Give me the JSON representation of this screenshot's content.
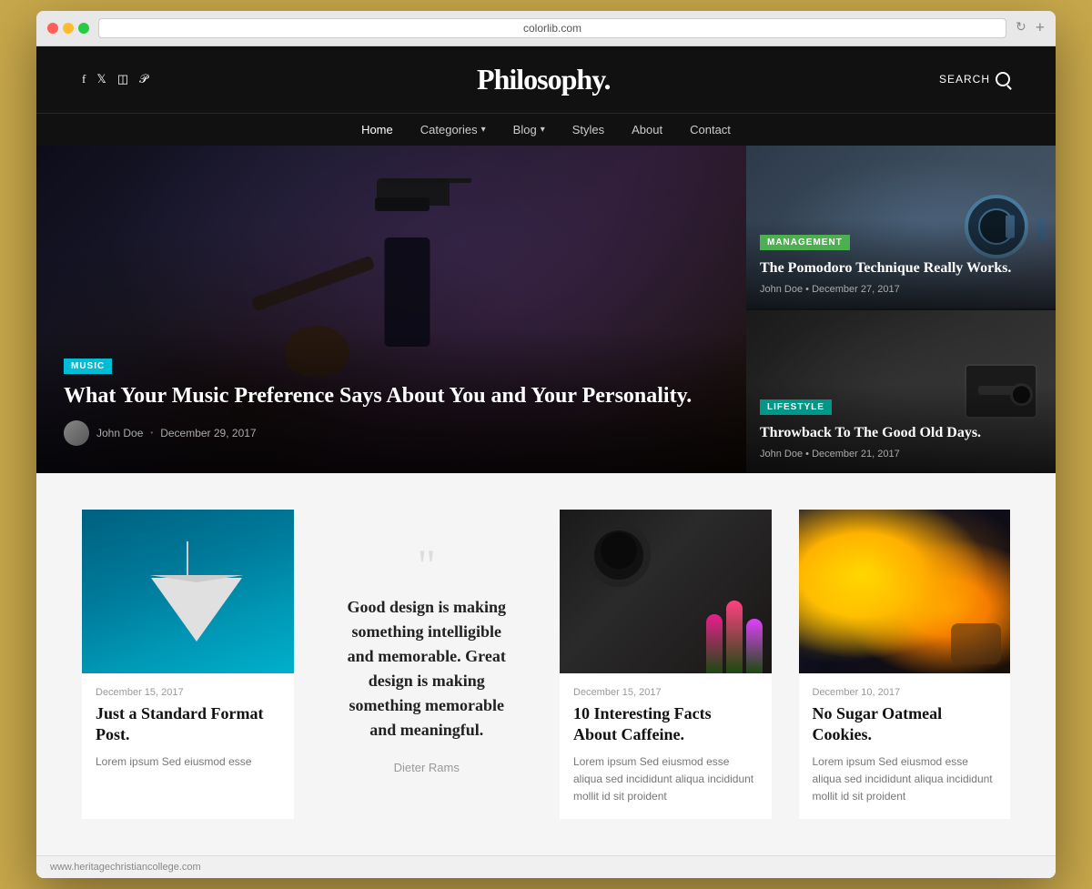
{
  "browser": {
    "url": "colorlib.com",
    "refresh_label": "↻",
    "add_tab_label": "+"
  },
  "header": {
    "logo": "Philosophy.",
    "search_label": "SEARCH",
    "social_icons": [
      "f",
      "t",
      "◻",
      "p"
    ]
  },
  "nav": {
    "items": [
      {
        "label": "Home",
        "active": true,
        "has_dropdown": false
      },
      {
        "label": "Categories",
        "active": false,
        "has_dropdown": true
      },
      {
        "label": "Blog",
        "active": false,
        "has_dropdown": true
      },
      {
        "label": "Styles",
        "active": false,
        "has_dropdown": false
      },
      {
        "label": "About",
        "active": false,
        "has_dropdown": false
      },
      {
        "label": "Contact",
        "active": false,
        "has_dropdown": false
      }
    ]
  },
  "hero": {
    "main": {
      "tag": "MUSIC",
      "title": "What Your Music Preference Says About You and Your Personality.",
      "author": "John Doe",
      "date": "December 29, 2017"
    },
    "side_top": {
      "tag": "MANAGEMENT",
      "title": "The Pomodoro Technique Really Works.",
      "author": "John Doe",
      "date": "December 27, 2017"
    },
    "side_bottom": {
      "tag": "LIFESTYLE",
      "title": "Throwback To The Good Old Days.",
      "author": "John Doe",
      "date": "December 21, 2017"
    }
  },
  "posts": {
    "lamp_post": {
      "date": "December 15, 2017",
      "title": "Just a Standard Format Post.",
      "excerpt": "Lorem ipsum Sed eiusmod esse"
    },
    "quote": {
      "marks": "““",
      "text": "Good design is making something intelligible and memorable. Great design is making something memorable and meaningful.",
      "author": "Dieter Rams"
    },
    "coffee_post": {
      "date": "December 15, 2017",
      "title": "10 Interesting Facts About Caffeine.",
      "excerpt": "Lorem ipsum Sed eiusmod esse aliqua sed incididunt aliqua incididunt mollit id sit proident"
    },
    "cookies_post": {
      "date": "December 10, 2017",
      "title": "No Sugar Oatmeal Cookies.",
      "excerpt": "Lorem ipsum Sed eiusmod esse aliqua sed incididunt aliqua incididunt mollit id sit proident"
    }
  },
  "footer": {
    "url": "www.heritagechristiancollege.com"
  }
}
